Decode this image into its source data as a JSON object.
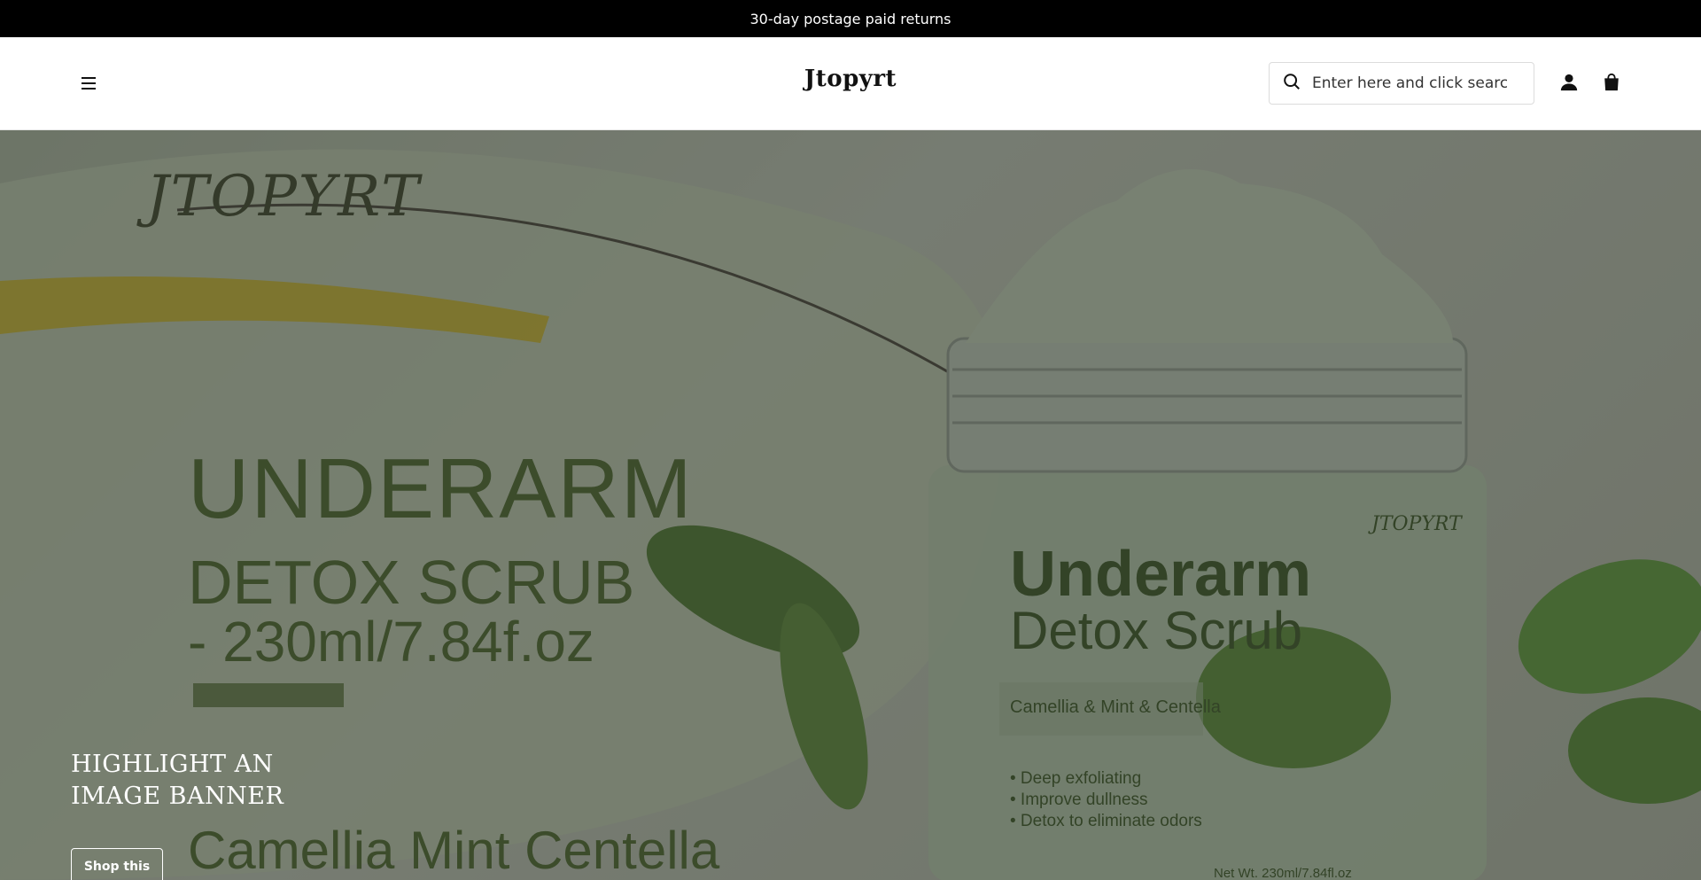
{
  "announcement": {
    "text": "30-day postage paid returns"
  },
  "header": {
    "logo": "Jtopyrt",
    "search": {
      "placeholder": "Enter here and click search",
      "value": ""
    },
    "icons": [
      "menu-icon",
      "search-icon",
      "account-icon",
      "cart-icon"
    ]
  },
  "hero": {
    "image_text": {
      "brand_mark": "JTOPYRT",
      "headline": "UNDERARM",
      "subline1": "DETOX SCRUB",
      "subline2": "- 230ml/7.84f.oz",
      "bottom": "Camellia Mint Centella",
      "jar_brand": "JTOPYRT",
      "jar_title1": "Underarm",
      "jar_title2": "Detox Scrub",
      "jar_ingredients": "Camellia & Mint & Centella",
      "jar_benefits": [
        "• Deep exfoliating",
        "• Improve dullness",
        "• Detox to eliminate odors"
      ],
      "jar_net": "Net Wt. 230ml/7.84fl.oz"
    },
    "heading_line1": "HIGHLIGHT AN",
    "heading_line2": "IMAGE BANNER",
    "button_label": "Shop this"
  },
  "colors": {
    "announcement_bg": "#000000",
    "accent_green": "#3d5a1e"
  }
}
